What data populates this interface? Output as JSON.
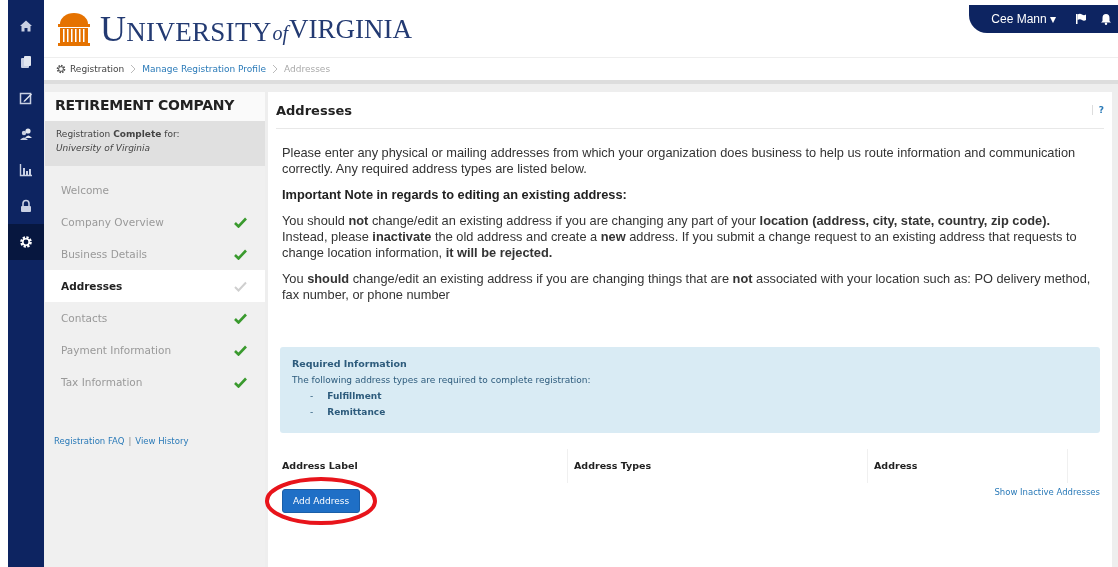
{
  "logo": {
    "word1": "UNIVERSITY",
    "word2": "of",
    "word3": "VIRGINIA"
  },
  "user_menu": {
    "name": "Cee Mann",
    "caret": "▾"
  },
  "rail": [
    {
      "selected": false
    },
    {
      "selected": false
    },
    {
      "selected": false
    },
    {
      "selected": false
    },
    {
      "selected": false
    },
    {
      "selected": false
    },
    {
      "selected": true
    }
  ],
  "breadcrumb": [
    {
      "label": "Registration",
      "kind": "root"
    },
    {
      "label": "Manage Registration Profile",
      "kind": "link"
    },
    {
      "label": "Addresses",
      "kind": "current"
    }
  ],
  "sidebar": {
    "title": "RETIREMENT COMPANY",
    "status": "Registration **Complete** for:",
    "organization": "University of Virginia",
    "items": [
      {
        "label": "Welcome",
        "kind": "intro",
        "selected": false
      },
      {
        "label": "Company Overview",
        "kind": "step",
        "selected": false,
        "checked": true
      },
      {
        "label": "Business Details",
        "kind": "step",
        "selected": false,
        "checked": true
      },
      {
        "label": "Addresses",
        "kind": "step",
        "selected": true,
        "checked": false
      },
      {
        "label": "Contacts",
        "kind": "step",
        "selected": false,
        "checked": true
      },
      {
        "label": "Payment Information",
        "kind": "step",
        "selected": false,
        "checked": true
      },
      {
        "label": "Tax Information",
        "kind": "step",
        "selected": false,
        "checked": true
      }
    ],
    "links": [
      "Registration FAQ",
      "View History"
    ],
    "separator": "|"
  },
  "panel": {
    "title": "Addresses",
    "help": "?",
    "paragraphs": [
      {
        "kind": "text",
        "text": "Please enter any physical or mailing addresses from which your organization does business to help us route information and communication correctly. Any required address types are listed below."
      },
      {
        "kind": "heading",
        "text": "Important Note in regards to editing an existing address:"
      },
      {
        "kind": "text",
        "text": "You should **not** change/edit an existing address if you are changing any part of your **location (address, city, state, country, zip code).** Instead, please **inactivate** the old address and create a **new** address. If you submit a change request to an existing address that requests to change location information, **it will be rejected.**"
      },
      {
        "kind": "text",
        "text": "You **should** change/edit an existing address if you are changing things that are **not** associated with your location such as: PO delivery method, fax number, or phone number"
      }
    ],
    "required": {
      "title": "Required Information",
      "text": "The following address types are required to complete registration:",
      "items": [
        "Fulfillment",
        "Remittance"
      ],
      "bullet": "-"
    },
    "table": {
      "columns": [
        "Address Label",
        "Address Types",
        "Address"
      ]
    },
    "add_button": "Add Address",
    "inactive_link": "Show Inactive Addresses"
  }
}
